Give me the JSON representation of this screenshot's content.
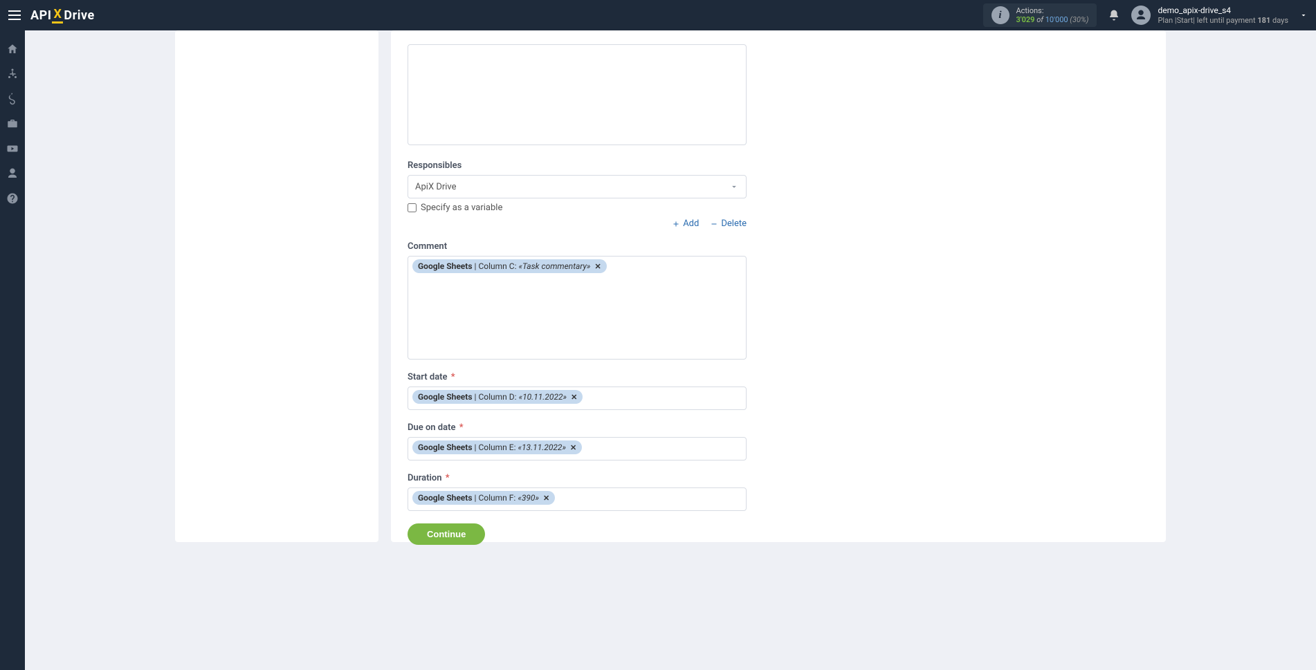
{
  "header": {
    "logo_parts": {
      "api": "API",
      "x": "X",
      "drive": "Drive"
    },
    "actions": {
      "label": "Actions:",
      "used": "3'029",
      "of": "of",
      "total": "10'000",
      "pct": "(30%)"
    },
    "user": {
      "name": "demo_apix-drive_s4",
      "plan_prefix": "Plan |Start| left until payment ",
      "plan_days": "181",
      "plan_suffix": " days"
    }
  },
  "form": {
    "responsibles": {
      "label": "Responsibles",
      "value": "ApiX Drive",
      "checkbox_label": "Specify as a variable",
      "add": "Add",
      "delete": "Delete"
    },
    "comment": {
      "label": "Comment",
      "tag": {
        "source": "Google Sheets",
        "col": "Column C:",
        "val": "«Task commentary»"
      }
    },
    "start_date": {
      "label": "Start date",
      "required": true,
      "tag": {
        "source": "Google Sheets",
        "col": "Column D:",
        "val": "«10.11.2022»"
      }
    },
    "due_date": {
      "label": "Due on date",
      "required": true,
      "tag": {
        "source": "Google Sheets",
        "col": "Column E:",
        "val": "«13.11.2022»"
      }
    },
    "duration": {
      "label": "Duration",
      "required": true,
      "tag": {
        "source": "Google Sheets",
        "col": "Column F:",
        "val": "«390»"
      }
    },
    "continue": "Continue"
  }
}
